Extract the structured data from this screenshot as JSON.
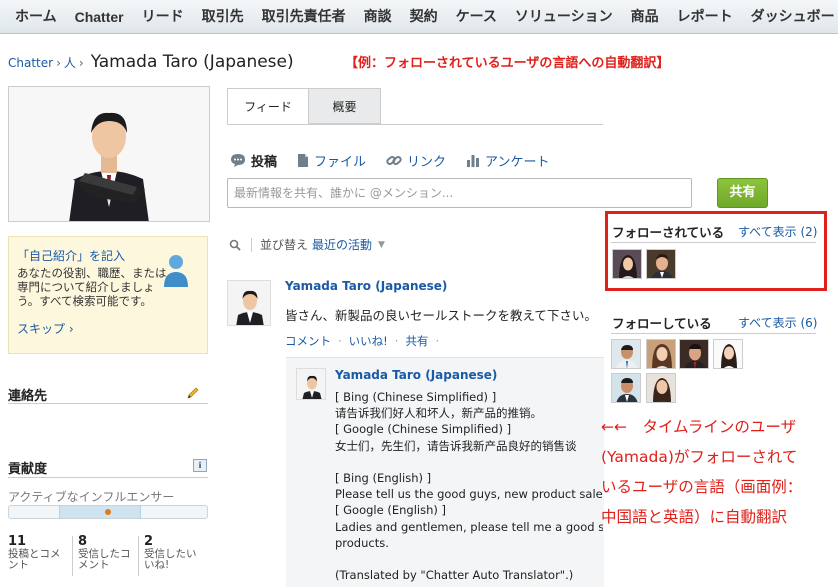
{
  "nav": {
    "items": [
      "ホーム",
      "Chatter",
      "リード",
      "取引先",
      "取引先責任者",
      "商談",
      "契約",
      "ケース",
      "ソリューション",
      "商品",
      "レポート",
      "ダッシュボード"
    ]
  },
  "breadcrumb": {
    "level1": "Chatter",
    "sep1": "›",
    "level2": "人",
    "sep2": "›",
    "title": "Yamada Taro (Japanese)"
  },
  "annotation_top": "【例：フォローされているユーザの言語への自動翻訳】",
  "intro": {
    "title": "「自己紹介」を記入",
    "text": "あなたの役割、職歴、または専門について紹介しましょう。すべて検索可能です。",
    "skip": "スキップ ›"
  },
  "contact": {
    "title": "連絡先"
  },
  "influence": {
    "title": "貢献度",
    "level": "アクティブなインフルエンサー",
    "level_fraction": 0.5,
    "info_icon": "i",
    "stats": [
      {
        "num": "11",
        "label": "投稿とコメント"
      },
      {
        "num": "8",
        "label": "受信したコメント"
      },
      {
        "num": "2",
        "label": "受信したいいね!"
      }
    ]
  },
  "tabs": [
    {
      "label": "フィード",
      "active": true
    },
    {
      "label": "概要",
      "active": false
    }
  ],
  "publisher": {
    "post": "投稿",
    "file": "ファイル",
    "link": "リンク",
    "poll": "アンケート",
    "placeholder": "最新情報を共有、誰かに @メンション...",
    "share": "共有"
  },
  "sort": {
    "label": "並び替え",
    "value": "最近の活動"
  },
  "feed": {
    "author": "Yamada Taro (Japanese)",
    "body": "皆さん、新製品の良いセールストークを教えて下さい。",
    "actions": [
      "コメント",
      "いいね!",
      "共有"
    ],
    "reply": {
      "author": "Yamada Taro (Japanese)",
      "lines": [
        "[ Bing (Chinese Simplified) ]",
        "请告诉我们好人和坏人，新产品的推销。",
        "[ Google (Chinese Simplified) ]",
        "女士们，先生们，请告诉我新产品良好的销售谈",
        "",
        "[ Bing (English) ]",
        "Please tell us the good guys, new product sales p",
        "[ Google (English) ]",
        "Ladies and gentlemen, please tell me a good sale",
        "products.",
        "",
        "(Translated by \"Chatter Auto Translator\".)"
      ]
    }
  },
  "followers": {
    "title": "フォローされている",
    "link": "すべて表示 (2)"
  },
  "following": {
    "title": "フォローしている",
    "link": "すべて表示 (6)"
  },
  "annotation_right": [
    "←←　タイムラインのユーザ",
    "(Yamada)がフォローされて",
    "いるユーザの言語（画面例：",
    "中国語と英語）に自動翻訳"
  ],
  "colors": {
    "accent": "#1a5aa5",
    "annotation": "#e0201a",
    "share": "#7ab534"
  }
}
